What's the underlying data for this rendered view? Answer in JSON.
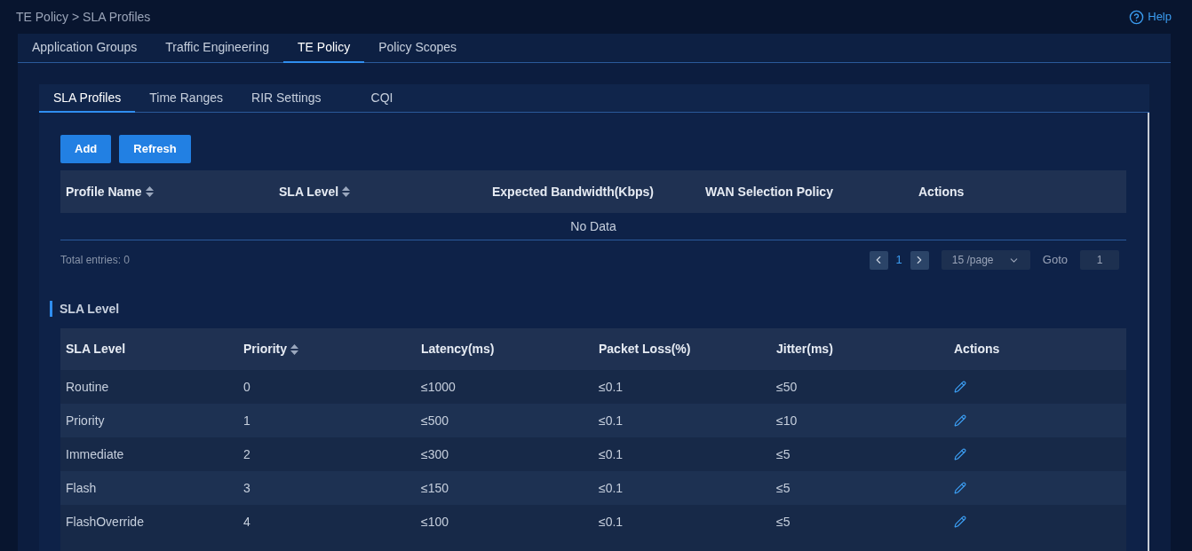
{
  "breadcrumb": "TE Policy > SLA Profiles",
  "help": {
    "label": "Help"
  },
  "main_tabs": [
    {
      "label": "Application Groups",
      "selected": false
    },
    {
      "label": "Traffic Engineering",
      "selected": false
    },
    {
      "label": "TE Policy",
      "selected": true
    },
    {
      "label": "Policy Scopes",
      "selected": false
    }
  ],
  "sub_tabs": [
    {
      "label": "SLA Profiles",
      "selected": true
    },
    {
      "label": "Time Ranges",
      "selected": false
    },
    {
      "label": "RIR Settings",
      "selected": false
    },
    {
      "label": "CQI",
      "selected": false
    }
  ],
  "buttons": [
    "Add",
    "Refresh"
  ],
  "profiles_table": {
    "columns": [
      {
        "label": "Profile Name",
        "sortable": true
      },
      {
        "label": "SLA Level",
        "sortable": true
      },
      {
        "label": "Expected Bandwidth(Kbps)",
        "sortable": false
      },
      {
        "label": "WAN Selection Policy",
        "sortable": false
      },
      {
        "label": "Actions",
        "sortable": false
      }
    ],
    "empty_text": "No Data"
  },
  "pagination": {
    "total": "Total entries: 0",
    "current_page": "1",
    "page_size": "15 /page",
    "goto_label": "Goto",
    "goto_value": "1"
  },
  "sla_section": {
    "title": "SLA Level",
    "columns": [
      {
        "label": "SLA Level",
        "sortable": false
      },
      {
        "label": "Priority",
        "sortable": true
      },
      {
        "label": "Latency(ms)",
        "sortable": false
      },
      {
        "label": "Packet Loss(%)",
        "sortable": false
      },
      {
        "label": "Jitter(ms)",
        "sortable": false
      },
      {
        "label": "Actions",
        "sortable": false
      }
    ],
    "rows": [
      {
        "cells": [
          "Routine",
          "0",
          "≤1000",
          "≤0.1",
          "≤50"
        ]
      },
      {
        "cells": [
          "Priority",
          "1",
          "≤500",
          "≤0.1",
          "≤10"
        ]
      },
      {
        "cells": [
          "Immediate",
          "2",
          "≤300",
          "≤0.1",
          "≤5"
        ]
      },
      {
        "cells": [
          "Flash",
          "3",
          "≤150",
          "≤0.1",
          "≤5"
        ]
      },
      {
        "cells": [
          "FlashOverride",
          "4",
          "≤100",
          "≤0.1",
          "≤5"
        ]
      }
    ]
  }
}
